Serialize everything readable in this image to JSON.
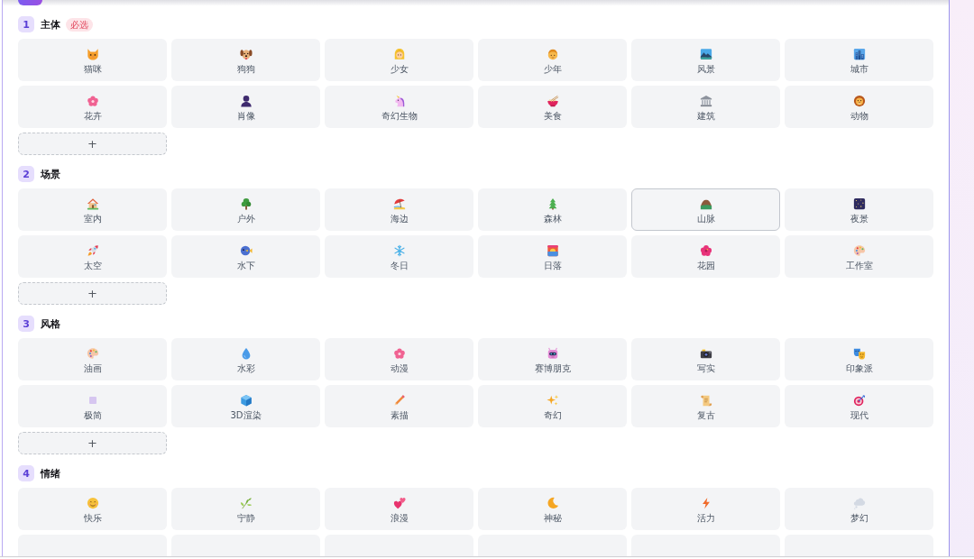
{
  "sections": [
    {
      "number": "1",
      "title": "主体",
      "tag": "必选",
      "options": [
        {
          "kind": "option",
          "label": "猫咪",
          "selected": false
        },
        {
          "kind": "option",
          "label": "狗狗",
          "selected": false
        },
        {
          "kind": "option",
          "label": "少女",
          "selected": false
        },
        {
          "kind": "option",
          "label": "少年",
          "selected": false
        },
        {
          "kind": "option",
          "label": "风景",
          "selected": false
        },
        {
          "kind": "option",
          "label": "城市",
          "selected": false
        },
        {
          "kind": "option",
          "label": "花卉",
          "selected": false
        },
        {
          "kind": "option",
          "label": "肖像",
          "selected": false
        },
        {
          "kind": "option",
          "label": "奇幻生物",
          "selected": false
        },
        {
          "kind": "option",
          "label": "美食",
          "selected": false
        },
        {
          "kind": "option",
          "label": "建筑",
          "selected": false
        },
        {
          "kind": "option",
          "label": "动物",
          "selected": false
        }
      ],
      "add_button": {
        "label": "+"
      }
    },
    {
      "number": "2",
      "title": "场景",
      "options": [
        {
          "kind": "option",
          "label": "室内",
          "selected": false
        },
        {
          "kind": "option",
          "label": "户外",
          "selected": false
        },
        {
          "kind": "option",
          "label": "海边",
          "selected": false
        },
        {
          "kind": "option",
          "label": "森林",
          "selected": false
        },
        {
          "kind": "option",
          "label": "山脉",
          "selected": true
        },
        {
          "kind": "option",
          "label": "夜景",
          "selected": false
        },
        {
          "kind": "option",
          "label": "太空",
          "selected": false
        },
        {
          "kind": "option",
          "label": "水下",
          "selected": false
        },
        {
          "kind": "option",
          "label": "冬日",
          "selected": false
        },
        {
          "kind": "option",
          "label": "日落",
          "selected": false
        },
        {
          "kind": "option",
          "label": "花园",
          "selected": false
        },
        {
          "kind": "option",
          "label": "工作室",
          "selected": false
        }
      ],
      "add_button": {
        "label": "+"
      }
    },
    {
      "number": "3",
      "title": "风格",
      "options": [
        {
          "kind": "option",
          "label": "油画",
          "selected": false
        },
        {
          "kind": "option",
          "label": "水彩",
          "selected": false
        },
        {
          "kind": "option",
          "label": "动漫",
          "selected": false
        },
        {
          "kind": "option",
          "label": "赛博朋克",
          "selected": false
        },
        {
          "kind": "option",
          "label": "写实",
          "selected": false
        },
        {
          "kind": "option",
          "label": "印象派",
          "selected": false
        },
        {
          "kind": "option",
          "label": "极简",
          "selected": false
        },
        {
          "kind": "option",
          "label": "3D渲染",
          "selected": false
        },
        {
          "kind": "option",
          "label": "素描",
          "selected": false
        },
        {
          "kind": "option",
          "label": "奇幻",
          "selected": false
        },
        {
          "kind": "option",
          "label": "复古",
          "selected": false
        },
        {
          "kind": "option",
          "label": "现代",
          "selected": false
        }
      ],
      "add_button": {
        "label": "+"
      }
    },
    {
      "number": "4",
      "title": "情绪",
      "options": [
        {
          "kind": "option",
          "label": "快乐",
          "selected": false
        },
        {
          "kind": "option",
          "label": "宁静",
          "selected": false
        },
        {
          "kind": "option",
          "label": "浪漫",
          "selected": false
        },
        {
          "kind": "option",
          "label": "神秘",
          "selected": false
        },
        {
          "kind": "option",
          "label": "活力",
          "selected": false
        },
        {
          "kind": "option",
          "label": "梦幻",
          "selected": false
        },
        {
          "kind": "cut_off",
          "selected": false
        },
        {
          "kind": "cut_off",
          "selected": false
        },
        {
          "kind": "cut_off",
          "selected": false
        },
        {
          "kind": "cut_off",
          "selected": false
        },
        {
          "kind": "cut_off",
          "selected": false
        },
        {
          "kind": "cut_off",
          "selected": false
        }
      ]
    }
  ]
}
